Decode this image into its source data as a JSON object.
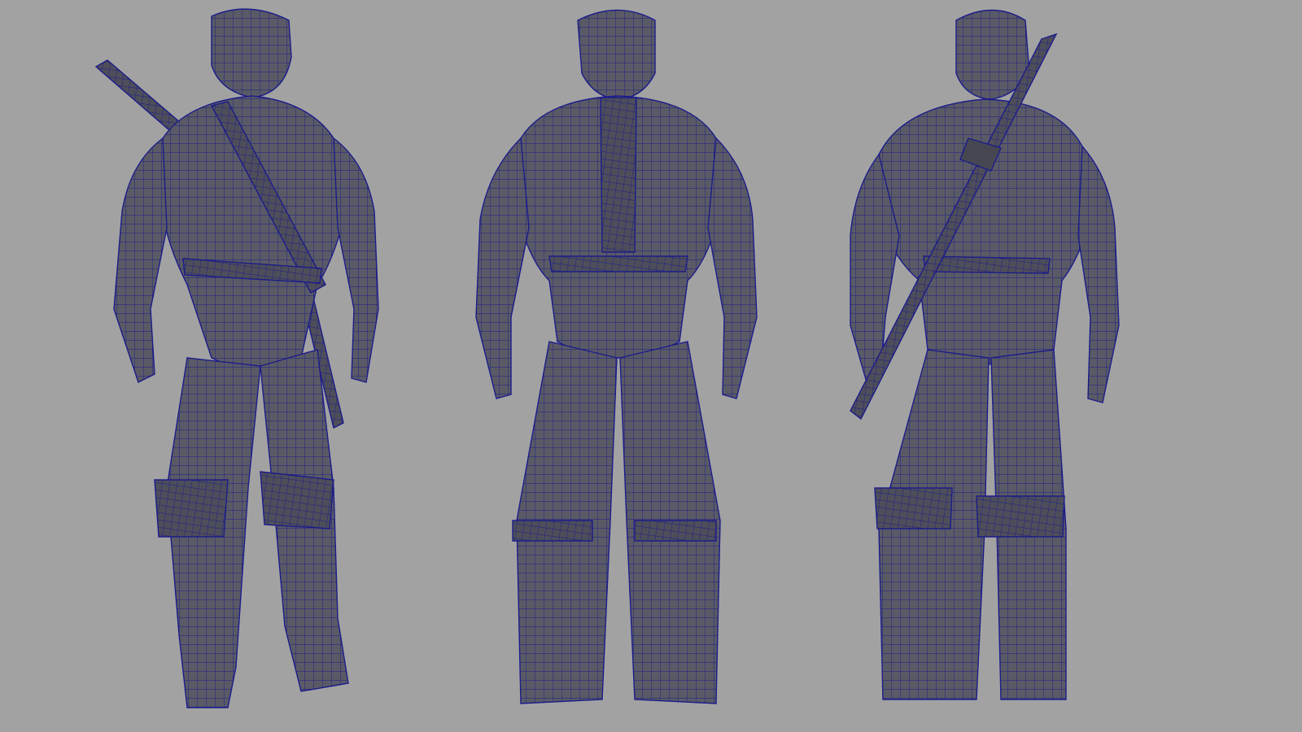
{
  "viewport": {
    "background_color": "#a2a2a2",
    "mesh_fill_color": "#5a5a66",
    "wireframe_color": "#1c1c8a"
  },
  "figures": [
    {
      "view": "three-quarter-front",
      "has_sword": true
    },
    {
      "view": "back",
      "has_sword": false
    },
    {
      "view": "three-quarter-back",
      "has_sword": true
    }
  ]
}
